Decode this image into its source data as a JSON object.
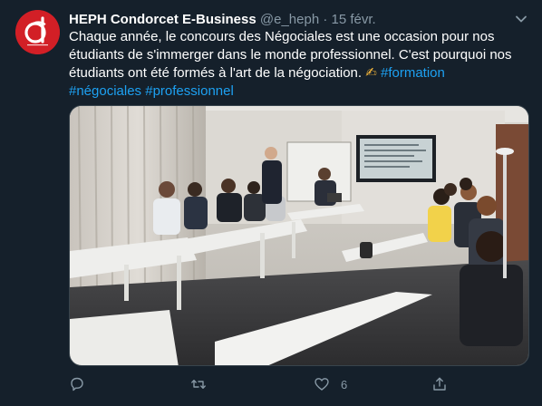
{
  "tweet": {
    "display_name": "HEPH Condorcet E-Business",
    "handle": "@e_heph",
    "separator": "·",
    "date": "15 févr.",
    "text_line1": "Chaque année, le concours des Négociales est une occasion pour nos",
    "text_line2": "étudiants de s'immerger dans le monde professionnel. C'est pourquoi nos",
    "text_line3": "étudiants ont été formés à l'art de la négociation. ",
    "emoji": "✍",
    "hashtags": [
      "#formation",
      "#négociales",
      "#professionnel"
    ],
    "avatar_logo_letters": "cd",
    "media_icon": "classroom-photo"
  },
  "actions": {
    "reply_icon": "reply-icon",
    "retweet_icon": "retweet-icon",
    "like_icon": "heart-icon",
    "like_count": "6",
    "share_icon": "share-icon"
  },
  "colors": {
    "background": "#15202b",
    "accent": "#1da1f2",
    "muted": "#8899a6",
    "avatar": "#d21f26"
  }
}
